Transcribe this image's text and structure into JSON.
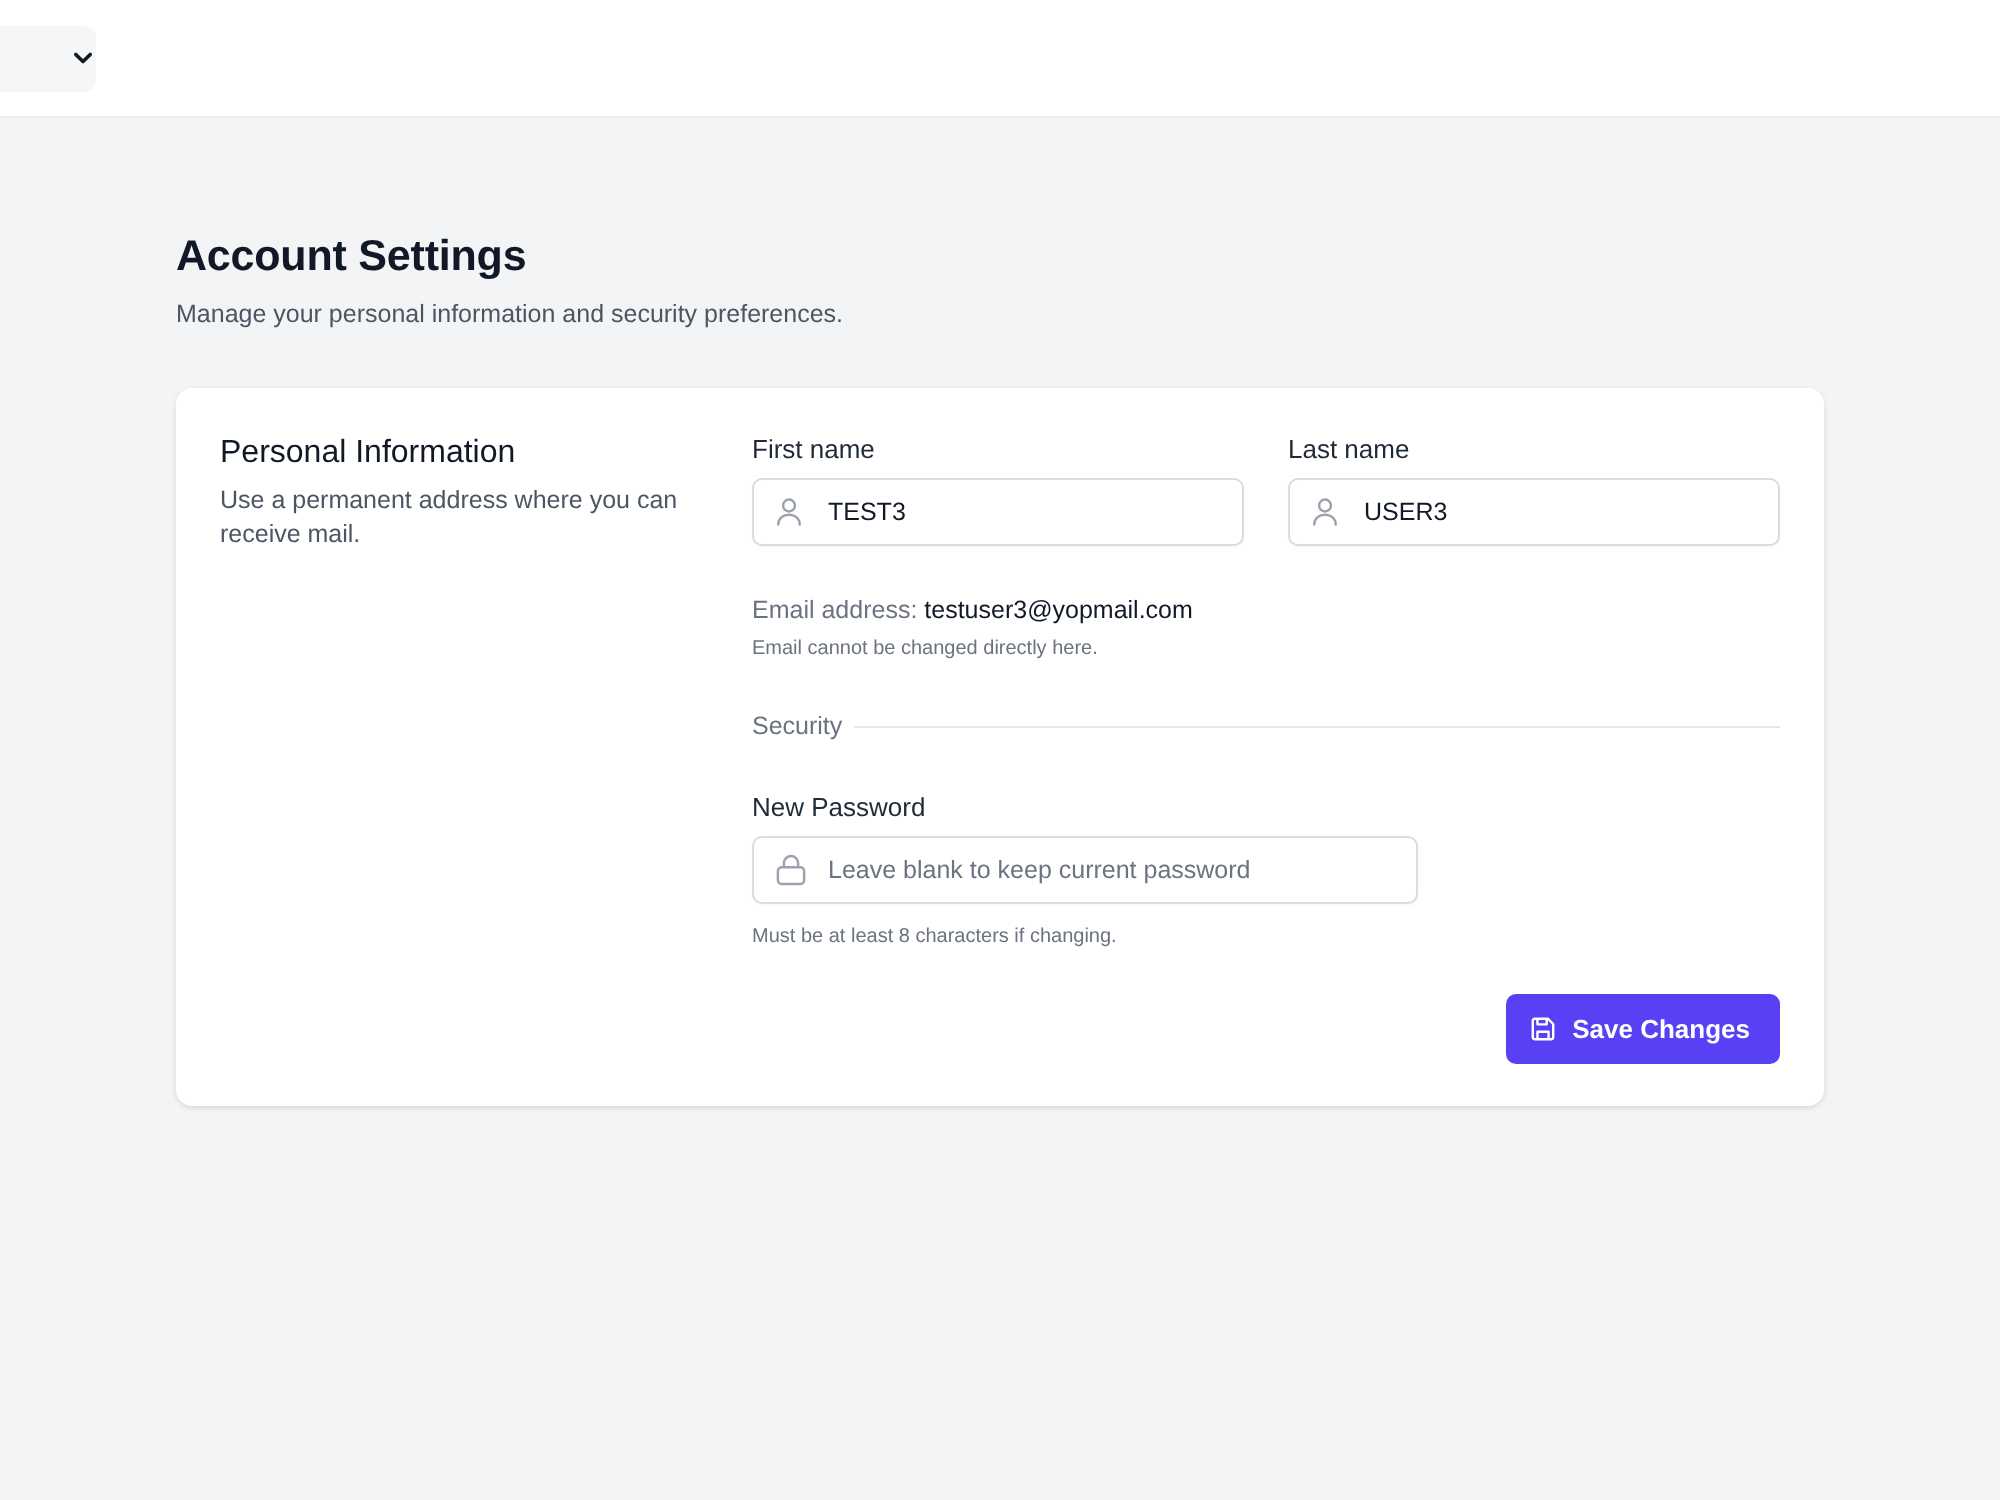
{
  "page": {
    "title": "Account Settings",
    "subtitle": "Manage your personal information and security preferences."
  },
  "personal_information": {
    "title": "Personal Information",
    "description": "Use a permanent address where you can receive mail."
  },
  "name_fields": [
    {
      "label": "First name",
      "value": "TEST3"
    },
    {
      "label": "Last name",
      "value": "USER3"
    }
  ],
  "email": {
    "text": "Email address: **testuser3@yopmail.com**",
    "note": "Email cannot be changed directly here."
  },
  "security": {
    "title": "Security",
    "password": {
      "label": "New Password",
      "placeholder": "Leave blank to keep current password",
      "hint": "Must be at least 8 characters if changing."
    }
  },
  "save_button": {
    "label": "Save Changes"
  }
}
